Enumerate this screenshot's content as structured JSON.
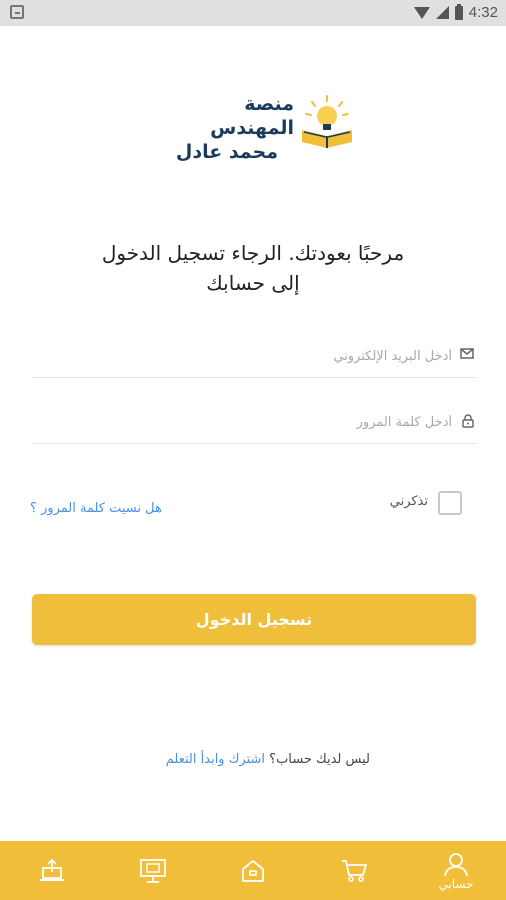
{
  "status_bar": {
    "time": "4:32"
  },
  "logo": {
    "line1": "منصة المهندس",
    "line2": "محمد عادل"
  },
  "welcome": {
    "line1": "مرحبًا بعودتك. الرجاء تسجيل الدخول",
    "line2": "إلى حسابك"
  },
  "form": {
    "email_placeholder": "أدخل البريد الإلكتروني",
    "email_value": "",
    "password_placeholder": "أدخل كلمة المرور",
    "password_value": "",
    "remember_label": "تذكرني",
    "remember_checked": false,
    "forgot_label": "هل نسيت كلمة المرور ؟",
    "login_label": "تسجيل الدخول"
  },
  "signup": {
    "text": "ليس لديك حساب؟",
    "link": "اشترك وابدأ التعلم"
  },
  "bottom_nav": {
    "items": [
      {
        "icon": "user-icon",
        "label": "حسابي",
        "active": true
      },
      {
        "icon": "cart-icon",
        "label": ""
      },
      {
        "icon": "home-icon",
        "label": ""
      },
      {
        "icon": "monitor-icon",
        "label": ""
      },
      {
        "icon": "upload-laptop-icon",
        "label": ""
      }
    ]
  },
  "colors": {
    "accent": "#efbe3a",
    "link": "#4a90e2",
    "brand_text": "#1b3a5c"
  }
}
